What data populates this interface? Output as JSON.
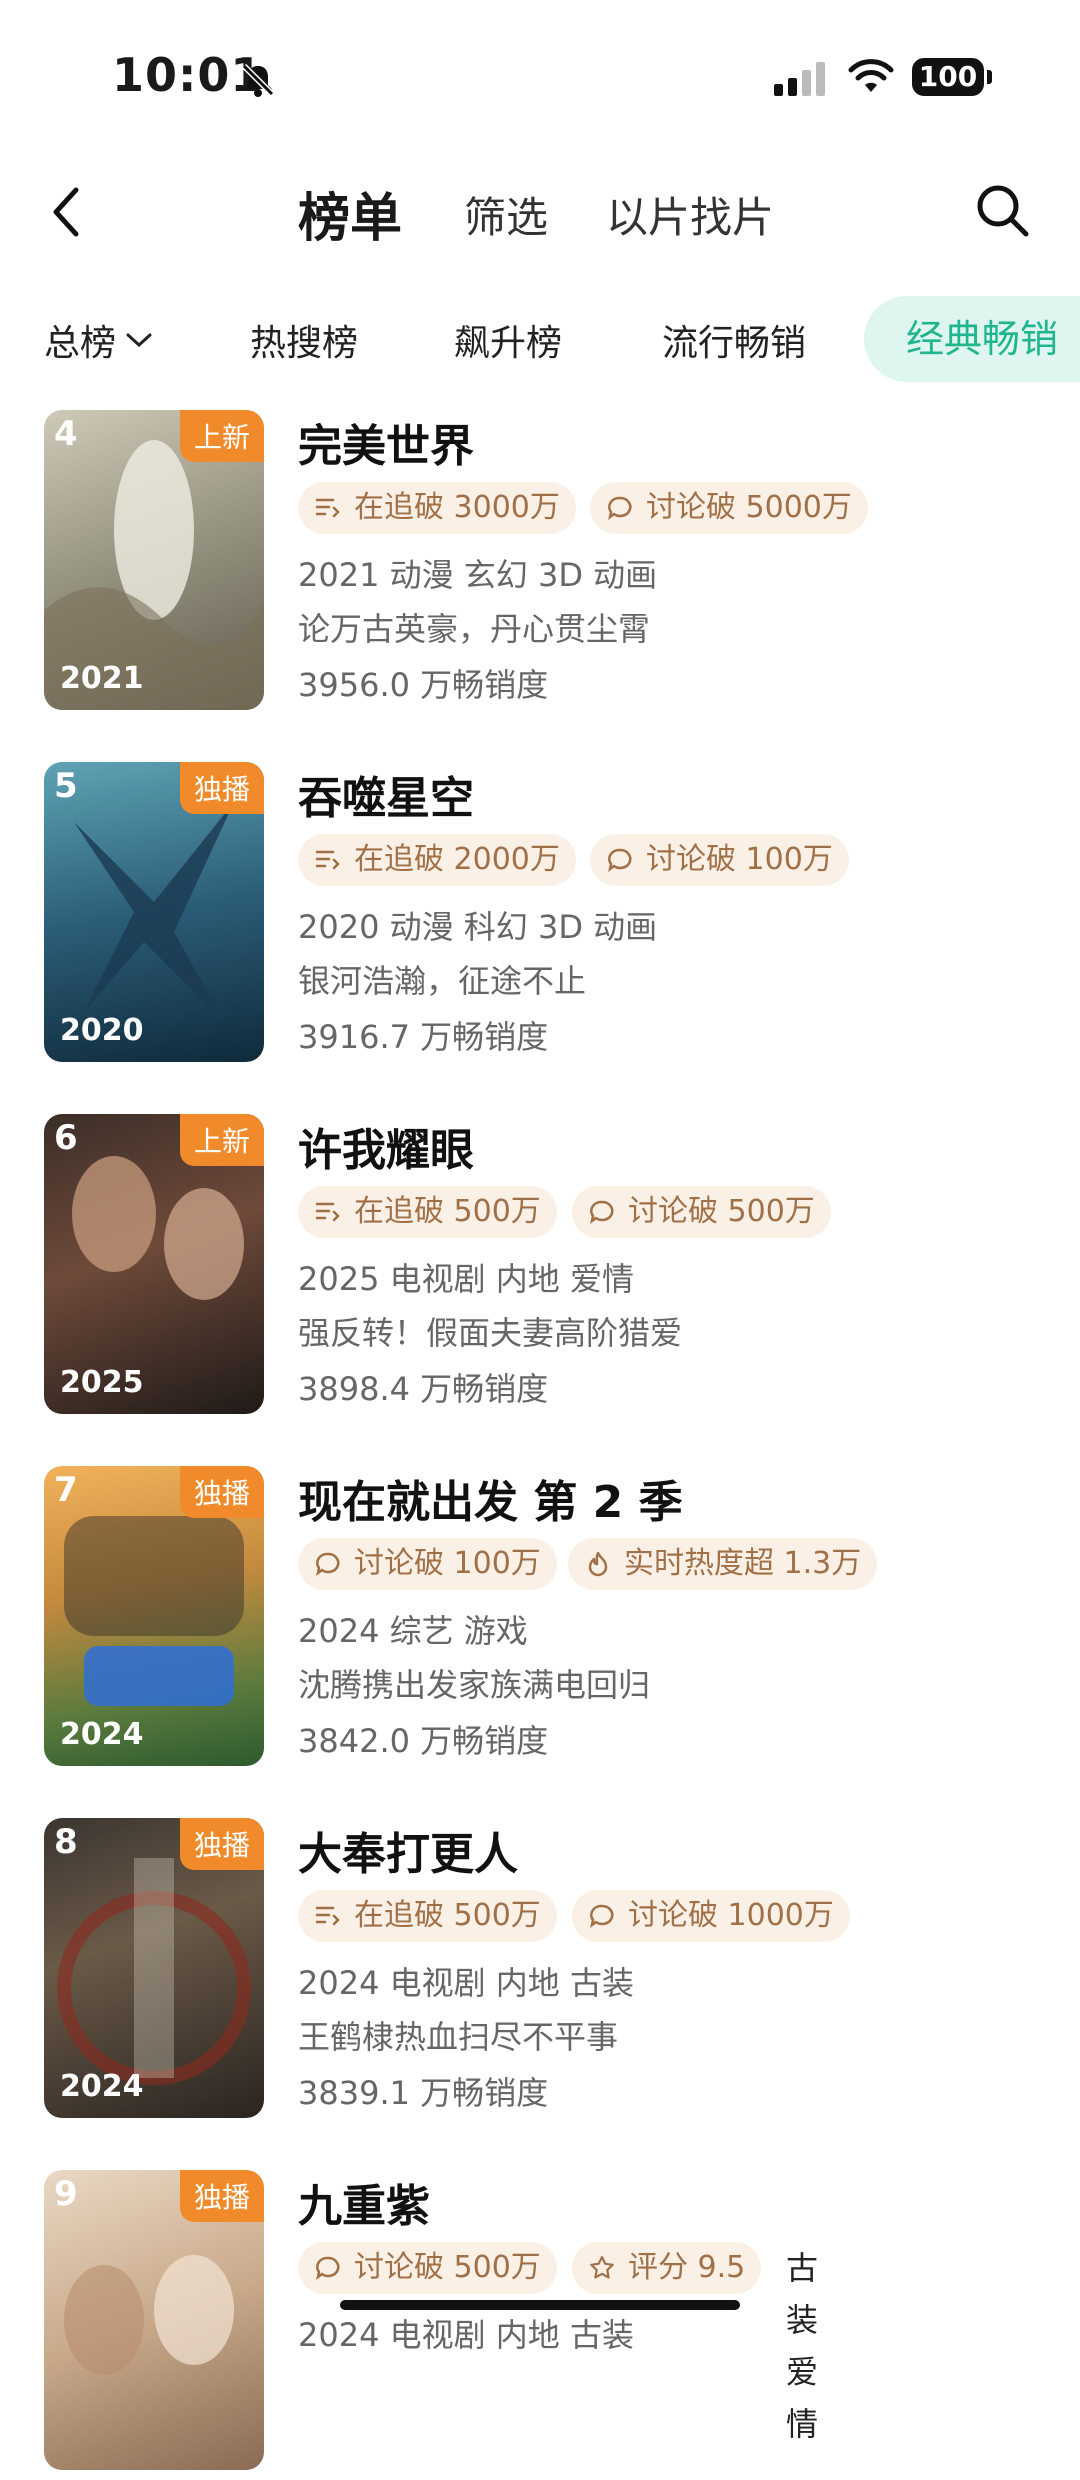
{
  "status": {
    "time": "10:01",
    "battery": "100"
  },
  "nav": {
    "title": "榜单",
    "filter": "筛选",
    "find": "以片找片"
  },
  "tabs": {
    "all": "总榜",
    "hot": "热搜榜",
    "rise": "飙升榜",
    "popular": "流行畅销",
    "classic": "经典畅销"
  },
  "items": [
    {
      "rank": "4",
      "badge": "上新",
      "year": "2021",
      "title": "完美世界",
      "chip1": "在追破 3000万",
      "chip2": "讨论破 5000万",
      "meta": "2021 动漫 玄幻 3D 动画",
      "desc": "论万古英豪，丹心贯尘霄",
      "heat": "3956.0 万畅销度"
    },
    {
      "rank": "5",
      "badge": "独播",
      "year": "2020",
      "title": "吞噬星空",
      "chip1": "在追破 2000万",
      "chip2": "讨论破 100万",
      "meta": "2020 动漫 科幻 3D 动画",
      "desc": "银河浩瀚，征途不止",
      "heat": "3916.7 万畅销度"
    },
    {
      "rank": "6",
      "badge": "上新",
      "year": "2025",
      "title": "许我耀眼",
      "chip1": "在追破 500万",
      "chip2": "讨论破 500万",
      "meta": "2025 电视剧 内地 爱情",
      "desc": "强反转！假面夫妻高阶猎爱",
      "heat": "3898.4 万畅销度"
    },
    {
      "rank": "7",
      "badge": "独播",
      "year": "2024",
      "title": "现在就出发 第 2 季",
      "chip1": "讨论破 100万",
      "chip2": "实时热度超 1.3万",
      "meta": "2024 综艺 游戏",
      "desc": "沈腾携出发家族满电回归",
      "heat": "3842.0 万畅销度"
    },
    {
      "rank": "8",
      "badge": "独播",
      "year": "2024",
      "title": "大奉打更人",
      "chip1": "在追破 500万",
      "chip2": "讨论破 1000万",
      "meta": "2024 电视剧 内地 古装",
      "desc": "王鹤棣热血扫尽不平事",
      "heat": "3839.1 万畅销度"
    },
    {
      "rank": "9",
      "badge": "独播",
      "year": "",
      "title": "九重紫",
      "chip1": "讨论破 500万",
      "chip2": "评分 9.5",
      "chip3": "古装爱情",
      "meta": "2024 电视剧 内地 古装",
      "desc": "",
      "heat": ""
    }
  ],
  "colors": {
    "accent": "#1fb58f",
    "badge": "#f08a2a",
    "chip_bg": "#fbf0e6",
    "chip_text": "#a07148"
  }
}
